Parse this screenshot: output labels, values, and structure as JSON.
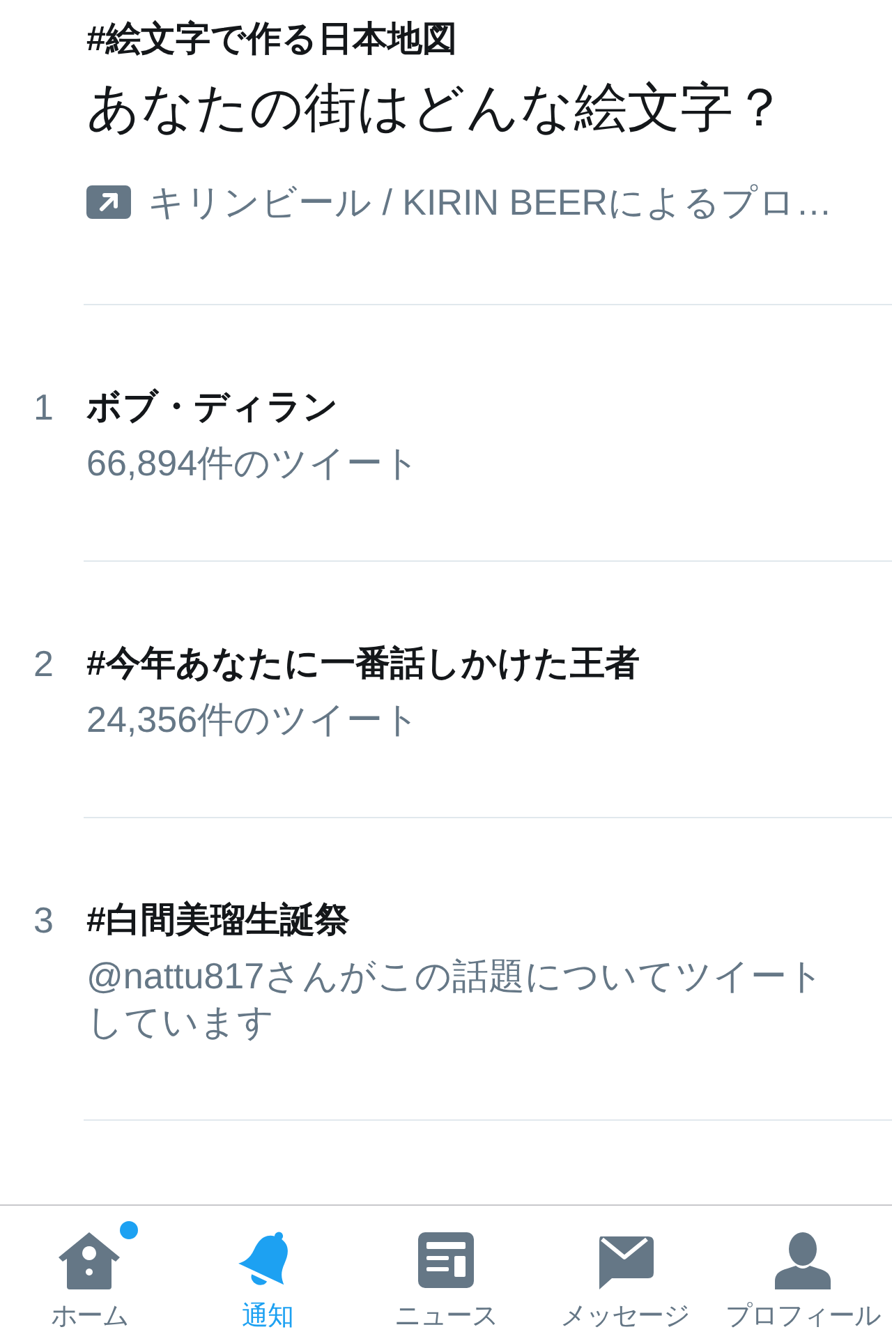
{
  "header": {
    "hashtag": "#絵文字で作る日本地図",
    "tagline": "あなたの街はどんな絵文字？",
    "promoted": "キリンビール / KIRIN BEERによるプロ…"
  },
  "trends": [
    {
      "rank": "1",
      "name": "ボブ・ディラン",
      "meta": "66,894件のツイート"
    },
    {
      "rank": "2",
      "name": "#今年あなたに一番話しかけた王者",
      "meta": "24,356件のツイート"
    },
    {
      "rank": "3",
      "name": "#白間美瑠生誕祭",
      "meta": "@nattu817さんがこの話題についてツイートしています"
    }
  ],
  "tab_bar": [
    {
      "kind": "home",
      "label": "ホーム",
      "selected": false,
      "badge": true
    },
    {
      "kind": "notifications",
      "label": "通知",
      "selected": true,
      "badge": false
    },
    {
      "kind": "news",
      "label": "ニュース",
      "selected": false,
      "badge": false
    },
    {
      "kind": "messages",
      "label": "メッセージ",
      "selected": false,
      "badge": false
    },
    {
      "kind": "profile",
      "label": "プロフィール",
      "selected": false,
      "badge": false
    }
  ]
}
